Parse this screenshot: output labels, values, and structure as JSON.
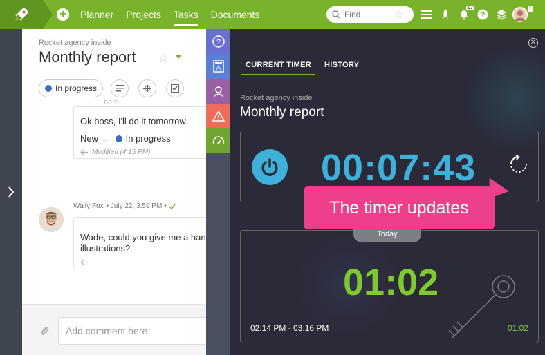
{
  "nav": {
    "items": [
      {
        "label": "Planner",
        "active": false
      },
      {
        "label": "Projects",
        "active": false
      },
      {
        "label": "Tasks",
        "active": true
      },
      {
        "label": "Documents",
        "active": false
      }
    ]
  },
  "search": {
    "placeholder": "Find"
  },
  "topbar": {
    "badge_label": "07",
    "avatar_count": "1"
  },
  "task": {
    "org": "Rocket agency inside",
    "title": "Monthly report",
    "status": "In progress",
    "faint_text": "here.",
    "message1": {
      "text": "Ok boss, I'll do it tomorrow.",
      "transition_from": "New →",
      "transition_to": "In progress",
      "modified": "Modified (4:15 PM)"
    },
    "message2": {
      "author": "Wally Fox",
      "date": "• July 22, 3:59 PM •",
      "line1": "Wade, could you give me a hand",
      "line2": "illustrations?"
    },
    "comment_placeholder": "Add comment here"
  },
  "timer": {
    "tabs": [
      {
        "label": "CURRENT TIMER",
        "active": true
      },
      {
        "label": "HISTORY",
        "active": false
      }
    ],
    "org": "Rocket agency inside",
    "title": "Monthly report",
    "current": "00:07:43",
    "today_label": "Today",
    "today_total": "01:02",
    "range": "02:14 PM - 03:16 PM",
    "range_duration": "01:02"
  },
  "callout": "The timer updates",
  "colors": {
    "brand_green": "#78b32a",
    "timer_blue": "#3eb0d9",
    "timer_green": "#7ec832",
    "callout_pink": "#ee3f8a",
    "status_blue": "#3b6fb5"
  }
}
